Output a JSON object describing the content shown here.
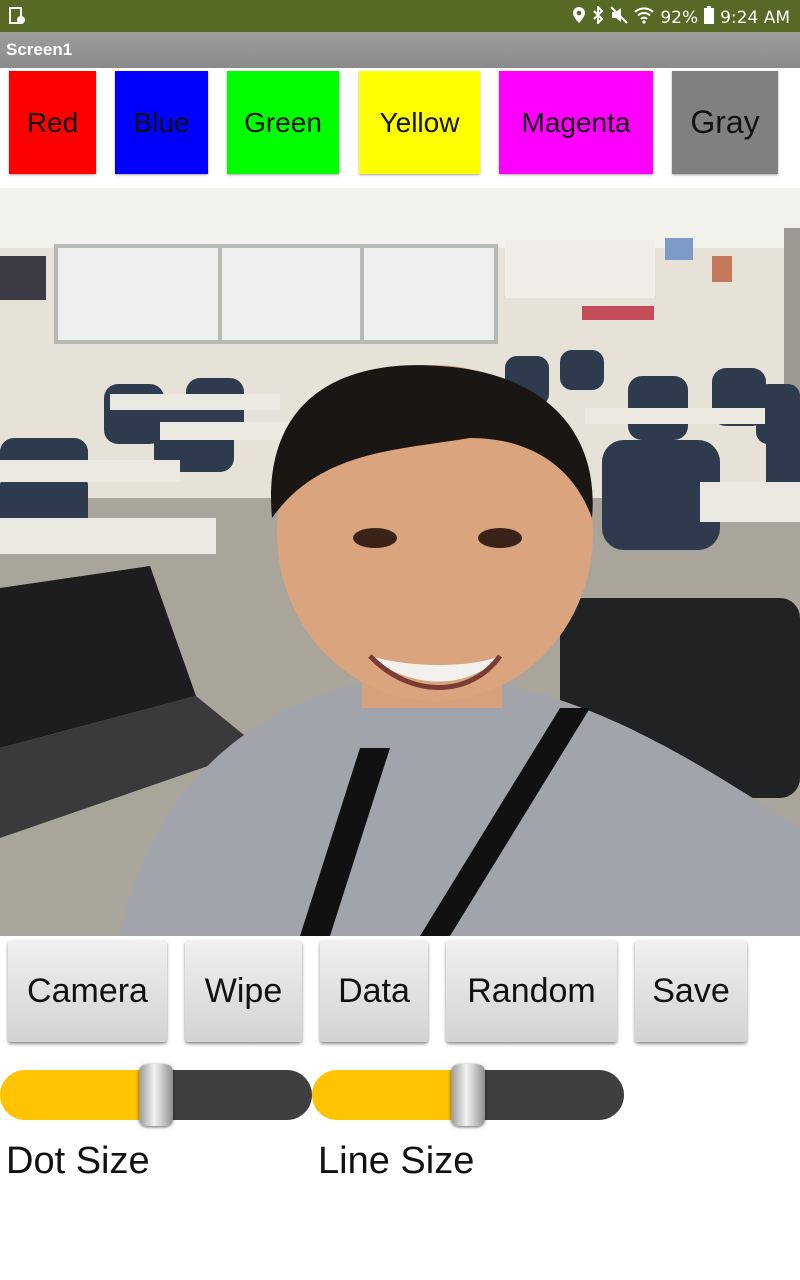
{
  "status_bar": {
    "battery": "92%",
    "time": "9:24 AM",
    "icons": [
      "notification-icon",
      "location-icon",
      "bluetooth-icon",
      "mute-icon",
      "wifi-icon",
      "battery-icon"
    ]
  },
  "app": {
    "title": "Screen1"
  },
  "color_buttons": [
    {
      "label": "Red",
      "color": "#ff0000"
    },
    {
      "label": "Blue",
      "color": "#0000ff"
    },
    {
      "label": "Green",
      "color": "#00ff00"
    },
    {
      "label": "Yellow",
      "color": "#ffff00"
    },
    {
      "label": "Magenta",
      "color": "#ff00ff"
    },
    {
      "label": "Gray",
      "color": "#808080"
    }
  ],
  "canvas": {
    "content": "selfie-photo"
  },
  "action_buttons": [
    "Camera",
    "Wipe",
    "Data",
    "Random",
    "Save"
  ],
  "sliders": [
    {
      "label": "Dot Size",
      "fill_fraction": 0.5
    },
    {
      "label": "Line Size",
      "fill_fraction": 0.5
    }
  ],
  "colors": {
    "status_bar": "#566a25",
    "title_bar": "#8f8f8f",
    "slider_fill": "#ffc400",
    "slider_track": "#3f3f3f"
  }
}
